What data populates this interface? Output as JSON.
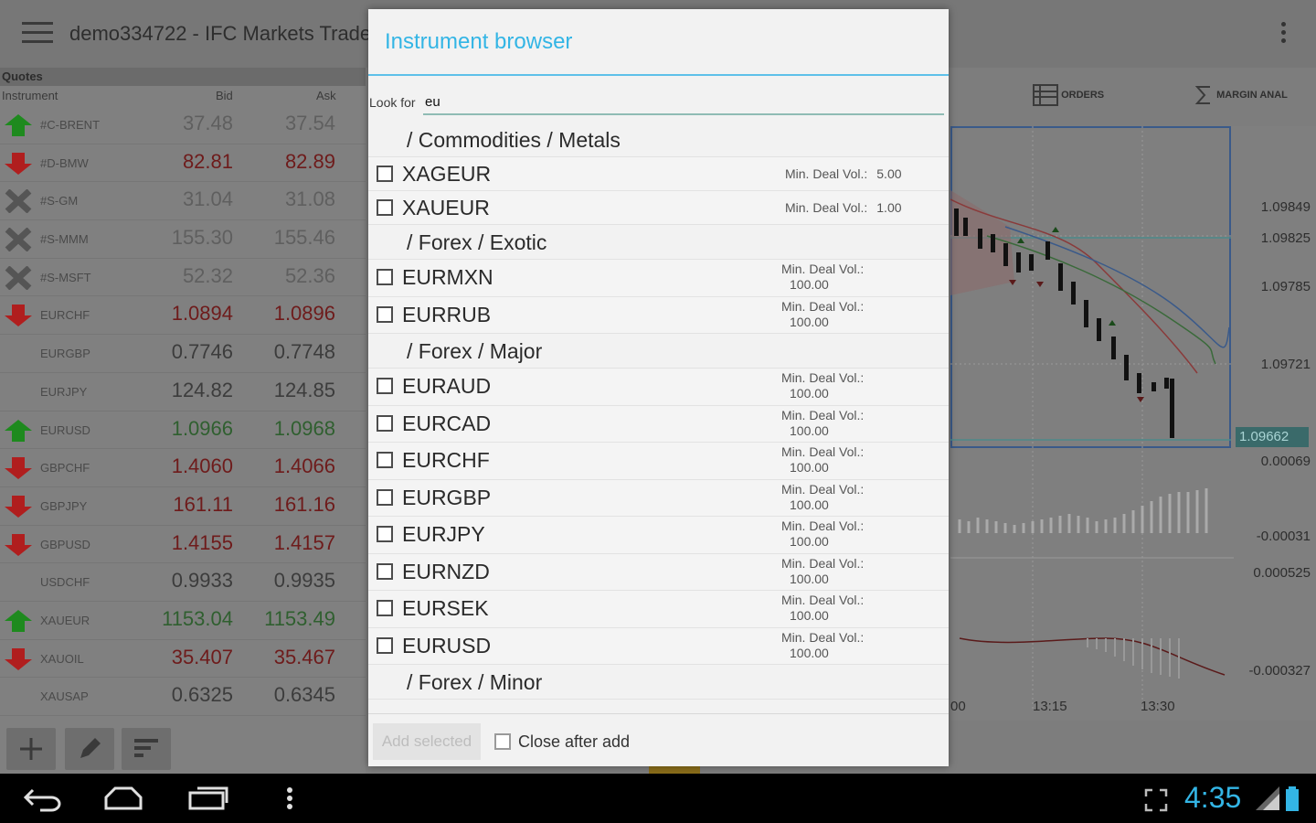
{
  "app": {
    "title": "demo334722 - IFC Markets Trade",
    "quotes": {
      "section_label": "Quotes",
      "col_instrument": "Instrument",
      "col_bid": "Bid",
      "col_ask": "Ask",
      "rows": [
        {
          "symbol": "#C-BRENT",
          "bid": "37.48",
          "ask": "37.54"
        },
        {
          "symbol": "#D-BMW",
          "bid": "82.81",
          "ask": "82.89"
        },
        {
          "symbol": "#S-GM",
          "bid": "31.04",
          "ask": "31.08"
        },
        {
          "symbol": "#S-MMM",
          "bid": "155.30",
          "ask": "155.46"
        },
        {
          "symbol": "#S-MSFT",
          "bid": "52.32",
          "ask": "52.36"
        },
        {
          "symbol": "EURCHF",
          "bid": "1.0894",
          "ask": "1.0896"
        },
        {
          "symbol": "EURGBP",
          "bid": "0.7746",
          "ask": "0.7748"
        },
        {
          "symbol": "EURJPY",
          "bid": "124.82",
          "ask": "124.85"
        },
        {
          "symbol": "EURUSD",
          "bid": "1.0966",
          "ask": "1.0968"
        },
        {
          "symbol": "GBPCHF",
          "bid": "1.4060",
          "ask": "1.4066"
        },
        {
          "symbol": "GBPJPY",
          "bid": "161.11",
          "ask": "161.16"
        },
        {
          "symbol": "GBPUSD",
          "bid": "1.4155",
          "ask": "1.4157"
        },
        {
          "symbol": "USDCHF",
          "bid": "0.9933",
          "ask": "0.9935"
        },
        {
          "symbol": "XAUEUR",
          "bid": "1153.04",
          "ask": "1153.49"
        },
        {
          "symbol": "XAUOIL",
          "bid": "35.407",
          "ask": "35.467"
        },
        {
          "symbol": "XAUSAP",
          "bid": "0.6325",
          "ask": "0.6345"
        }
      ]
    },
    "chart_tabs": {
      "orders": "ORDERS",
      "margin": "MARGIN ANAL"
    },
    "price_labels": [
      "1.09849",
      "1.09825",
      "1.09785",
      "1.09721"
    ],
    "current_price": "1.09662",
    "osc1_labels": [
      "0.00069",
      "-0.00031"
    ],
    "osc2_labels": [
      "0.000525",
      "-0.000327"
    ],
    "time_labels": [
      "00",
      "13:15",
      "13:30"
    ]
  },
  "dialog": {
    "title": "Instrument browser",
    "lookfor_label": "Look for",
    "lookfor_value": "eu",
    "categories": {
      "c1": "/ Commodities / Metals",
      "c2": "/ Forex / Exotic",
      "c3": "/ Forex / Major",
      "c4": "/ Forex / Minor"
    },
    "min_deal_label": "Min. Deal Vol.:",
    "items": {
      "xageur": {
        "name": "XAGEUR",
        "vol": "5.00"
      },
      "xaueur": {
        "name": "XAUEUR",
        "vol": "1.00"
      },
      "eurmxn": {
        "name": "EURMXN",
        "vol": "100.00"
      },
      "eurrub": {
        "name": "EURRUB",
        "vol": "100.00"
      },
      "euraud": {
        "name": "EURAUD",
        "vol": "100.00"
      },
      "eurcad": {
        "name": "EURCAD",
        "vol": "100.00"
      },
      "eurchf": {
        "name": "EURCHF",
        "vol": "100.00"
      },
      "eurgbp": {
        "name": "EURGBP",
        "vol": "100.00"
      },
      "eurjpy": {
        "name": "EURJPY",
        "vol": "100.00"
      },
      "eurnzd": {
        "name": "EURNZD",
        "vol": "100.00"
      },
      "eursek": {
        "name": "EURSEK",
        "vol": "100.00"
      },
      "eurusd": {
        "name": "EURUSD",
        "vol": "100.00"
      }
    },
    "add_selected": "Add selected",
    "close_after_add": "Close after add"
  },
  "status": {
    "time": "4:35"
  },
  "colors": {
    "accent": "#33b5e5",
    "up": "#1e8a1e",
    "down": "#b01e1e"
  }
}
